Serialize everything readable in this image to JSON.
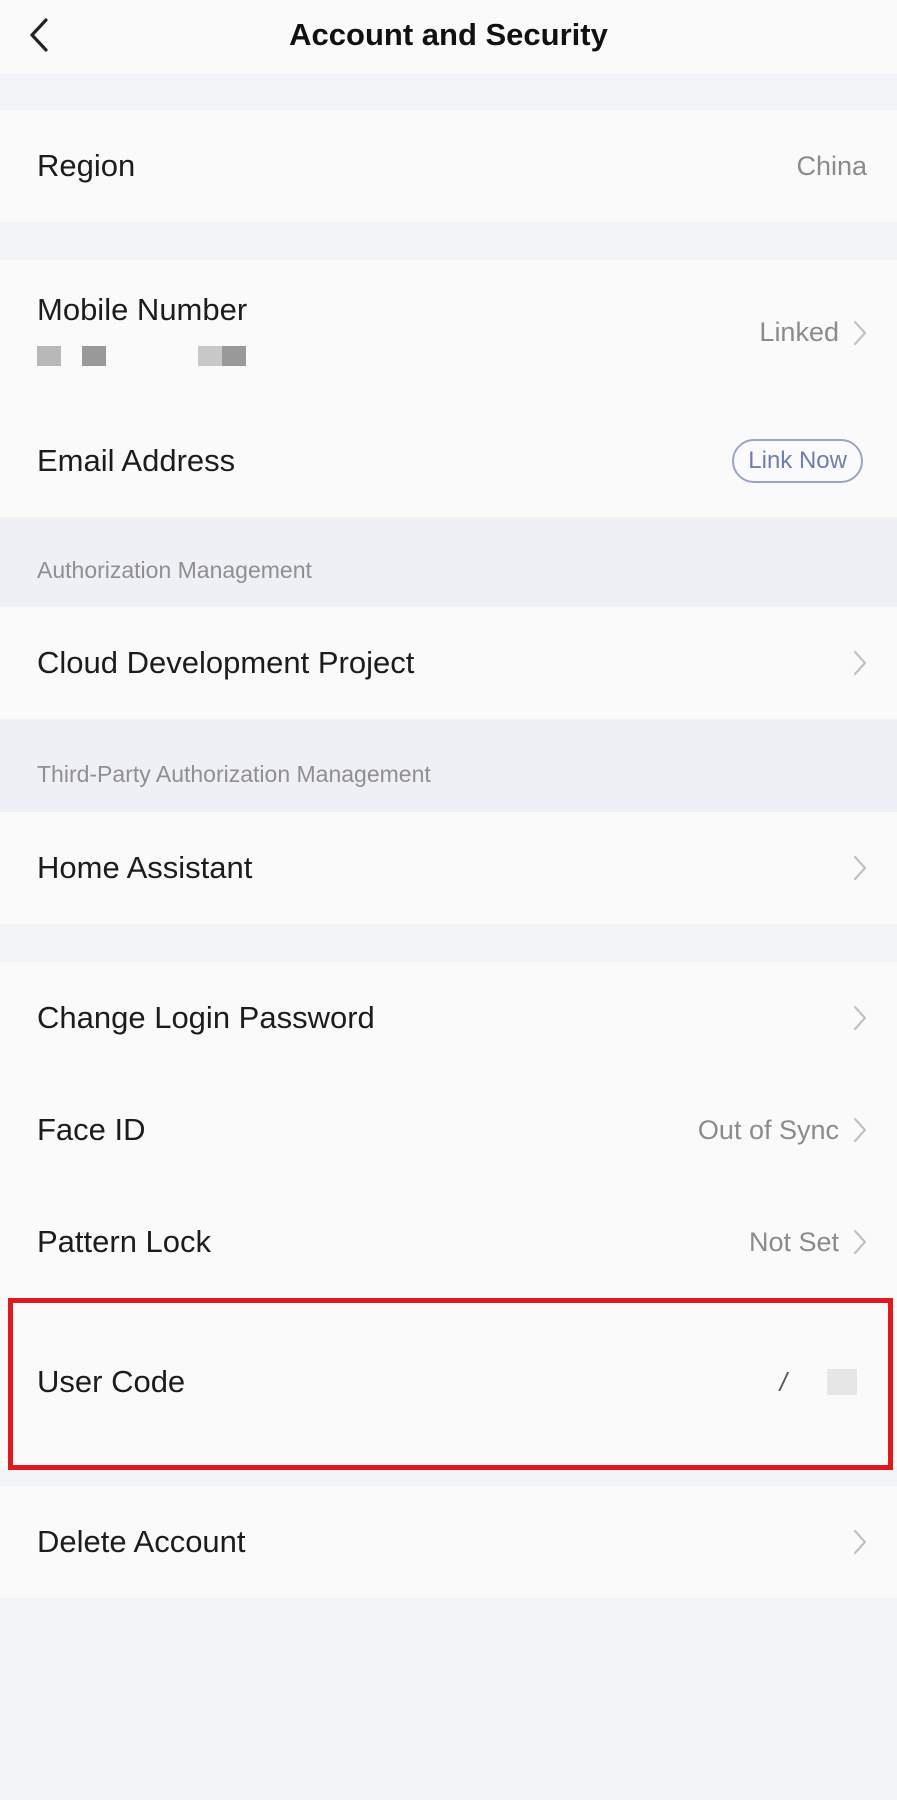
{
  "header": {
    "title": "Account and Security",
    "back_icon": "chevron-left-icon"
  },
  "region": {
    "label": "Region",
    "value": "China"
  },
  "mobile": {
    "label": "Mobile Number",
    "status": "Linked"
  },
  "email": {
    "label": "Email Address",
    "action": "Link Now"
  },
  "authorization": {
    "section_title": "Authorization Management",
    "items": [
      {
        "label": "Cloud Development Project"
      }
    ]
  },
  "third_party": {
    "section_title": "Third-Party Authorization Management",
    "items": [
      {
        "label": "Home Assistant"
      }
    ]
  },
  "security": {
    "change_password": {
      "label": "Change Login Password"
    },
    "face_id": {
      "label": "Face ID",
      "value": "Out of Sync"
    },
    "pattern_lock": {
      "label": "Pattern Lock",
      "value": "Not Set"
    },
    "user_code": {
      "label": "User Code",
      "value": "/"
    }
  },
  "delete_account": {
    "label": "Delete Account"
  },
  "colors": {
    "background": "#f2f3f7",
    "row_background": "#fafafa",
    "highlight": "#e0191e",
    "link_accent": "#6e7fae"
  }
}
